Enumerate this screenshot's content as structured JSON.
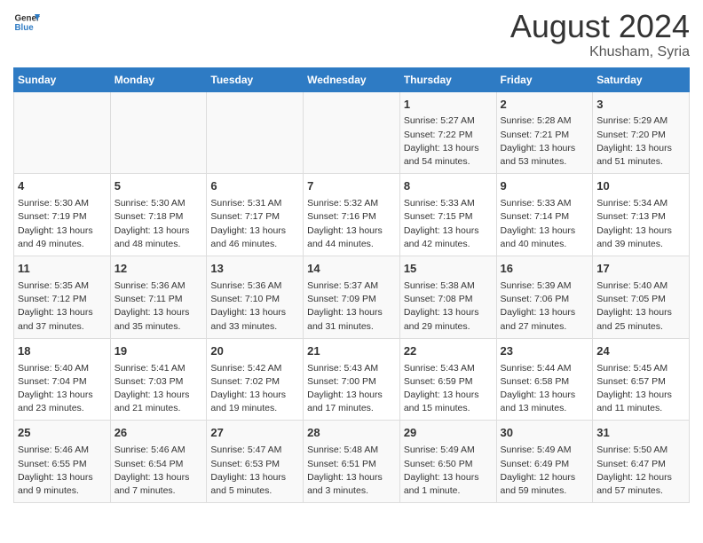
{
  "header": {
    "logo_line1": "General",
    "logo_line2": "Blue",
    "title": "August 2024",
    "subtitle": "Khusham, Syria"
  },
  "days_of_week": [
    "Sunday",
    "Monday",
    "Tuesday",
    "Wednesday",
    "Thursday",
    "Friday",
    "Saturday"
  ],
  "weeks": [
    [
      {
        "day": "",
        "content": ""
      },
      {
        "day": "",
        "content": ""
      },
      {
        "day": "",
        "content": ""
      },
      {
        "day": "",
        "content": ""
      },
      {
        "day": "1",
        "content": "Sunrise: 5:27 AM\nSunset: 7:22 PM\nDaylight: 13 hours and 54 minutes."
      },
      {
        "day": "2",
        "content": "Sunrise: 5:28 AM\nSunset: 7:21 PM\nDaylight: 13 hours and 53 minutes."
      },
      {
        "day": "3",
        "content": "Sunrise: 5:29 AM\nSunset: 7:20 PM\nDaylight: 13 hours and 51 minutes."
      }
    ],
    [
      {
        "day": "4",
        "content": "Sunrise: 5:30 AM\nSunset: 7:19 PM\nDaylight: 13 hours and 49 minutes."
      },
      {
        "day": "5",
        "content": "Sunrise: 5:30 AM\nSunset: 7:18 PM\nDaylight: 13 hours and 48 minutes."
      },
      {
        "day": "6",
        "content": "Sunrise: 5:31 AM\nSunset: 7:17 PM\nDaylight: 13 hours and 46 minutes."
      },
      {
        "day": "7",
        "content": "Sunrise: 5:32 AM\nSunset: 7:16 PM\nDaylight: 13 hours and 44 minutes."
      },
      {
        "day": "8",
        "content": "Sunrise: 5:33 AM\nSunset: 7:15 PM\nDaylight: 13 hours and 42 minutes."
      },
      {
        "day": "9",
        "content": "Sunrise: 5:33 AM\nSunset: 7:14 PM\nDaylight: 13 hours and 40 minutes."
      },
      {
        "day": "10",
        "content": "Sunrise: 5:34 AM\nSunset: 7:13 PM\nDaylight: 13 hours and 39 minutes."
      }
    ],
    [
      {
        "day": "11",
        "content": "Sunrise: 5:35 AM\nSunset: 7:12 PM\nDaylight: 13 hours and 37 minutes."
      },
      {
        "day": "12",
        "content": "Sunrise: 5:36 AM\nSunset: 7:11 PM\nDaylight: 13 hours and 35 minutes."
      },
      {
        "day": "13",
        "content": "Sunrise: 5:36 AM\nSunset: 7:10 PM\nDaylight: 13 hours and 33 minutes."
      },
      {
        "day": "14",
        "content": "Sunrise: 5:37 AM\nSunset: 7:09 PM\nDaylight: 13 hours and 31 minutes."
      },
      {
        "day": "15",
        "content": "Sunrise: 5:38 AM\nSunset: 7:08 PM\nDaylight: 13 hours and 29 minutes."
      },
      {
        "day": "16",
        "content": "Sunrise: 5:39 AM\nSunset: 7:06 PM\nDaylight: 13 hours and 27 minutes."
      },
      {
        "day": "17",
        "content": "Sunrise: 5:40 AM\nSunset: 7:05 PM\nDaylight: 13 hours and 25 minutes."
      }
    ],
    [
      {
        "day": "18",
        "content": "Sunrise: 5:40 AM\nSunset: 7:04 PM\nDaylight: 13 hours and 23 minutes."
      },
      {
        "day": "19",
        "content": "Sunrise: 5:41 AM\nSunset: 7:03 PM\nDaylight: 13 hours and 21 minutes."
      },
      {
        "day": "20",
        "content": "Sunrise: 5:42 AM\nSunset: 7:02 PM\nDaylight: 13 hours and 19 minutes."
      },
      {
        "day": "21",
        "content": "Sunrise: 5:43 AM\nSunset: 7:00 PM\nDaylight: 13 hours and 17 minutes."
      },
      {
        "day": "22",
        "content": "Sunrise: 5:43 AM\nSunset: 6:59 PM\nDaylight: 13 hours and 15 minutes."
      },
      {
        "day": "23",
        "content": "Sunrise: 5:44 AM\nSunset: 6:58 PM\nDaylight: 13 hours and 13 minutes."
      },
      {
        "day": "24",
        "content": "Sunrise: 5:45 AM\nSunset: 6:57 PM\nDaylight: 13 hours and 11 minutes."
      }
    ],
    [
      {
        "day": "25",
        "content": "Sunrise: 5:46 AM\nSunset: 6:55 PM\nDaylight: 13 hours and 9 minutes."
      },
      {
        "day": "26",
        "content": "Sunrise: 5:46 AM\nSunset: 6:54 PM\nDaylight: 13 hours and 7 minutes."
      },
      {
        "day": "27",
        "content": "Sunrise: 5:47 AM\nSunset: 6:53 PM\nDaylight: 13 hours and 5 minutes."
      },
      {
        "day": "28",
        "content": "Sunrise: 5:48 AM\nSunset: 6:51 PM\nDaylight: 13 hours and 3 minutes."
      },
      {
        "day": "29",
        "content": "Sunrise: 5:49 AM\nSunset: 6:50 PM\nDaylight: 13 hours and 1 minute."
      },
      {
        "day": "30",
        "content": "Sunrise: 5:49 AM\nSunset: 6:49 PM\nDaylight: 12 hours and 59 minutes."
      },
      {
        "day": "31",
        "content": "Sunrise: 5:50 AM\nSunset: 6:47 PM\nDaylight: 12 hours and 57 minutes."
      }
    ]
  ]
}
